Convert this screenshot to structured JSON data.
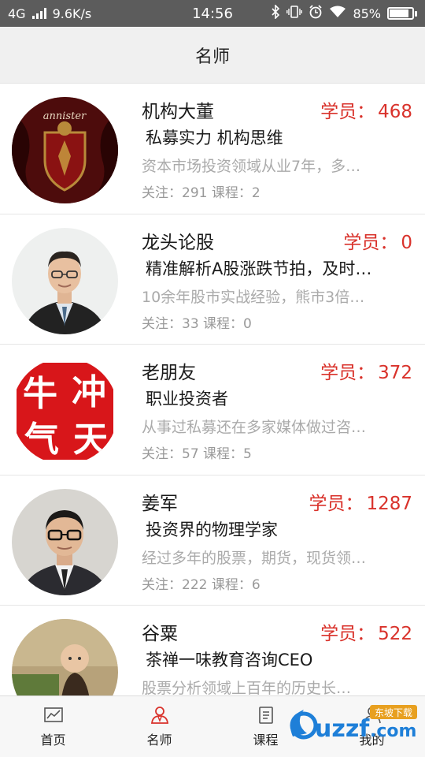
{
  "status_bar": {
    "network": "4G",
    "speed": "9.6K/s",
    "time": "14:56",
    "battery": "85%",
    "battery_level": 0.85
  },
  "header": {
    "title": "名师"
  },
  "colors": {
    "accent": "#d9322b",
    "header_bg": "#f0f0f0",
    "status_bg": "#5c5c5c"
  },
  "teachers": [
    {
      "name": "机构大董",
      "students_label": "学员：",
      "students": "468",
      "title": "私募实力 机构思维",
      "desc": "资本市场投资领域从业7年，多…",
      "stats": "关注：291 课程：2",
      "avatar_icon": "crest-avatar"
    },
    {
      "name": "龙头论股",
      "students_label": "学员：",
      "students": "0",
      "title": "精准解析A股涨跌节拍，及时…",
      "desc": "10余年股市实战经验，熊市3倍…",
      "stats": "关注：33 课程：0",
      "avatar_icon": "man-suit-avatar"
    },
    {
      "name": "老朋友",
      "students_label": "学员：",
      "students": "372",
      "title": "职业投资者",
      "desc": "从事过私募还在多家媒体做过咨…",
      "stats": "关注：57 课程：5",
      "avatar_icon": "seal-avatar"
    },
    {
      "name": "姜军",
      "students_label": "学员：",
      "students": "1287",
      "title": "投资界的物理学家",
      "desc": "经过多年的股票，期货，现货领…",
      "stats": "关注：222 课程：6",
      "avatar_icon": "man-glasses-avatar"
    },
    {
      "name": "谷粟",
      "students_label": "学员：",
      "students": "522",
      "title": "茶禅一味教育咨询CEO",
      "desc": "股票分析领域上百年的历史长…",
      "stats": "",
      "avatar_icon": "child-monk-avatar"
    }
  ],
  "seal_text": [
    "牛",
    "冲",
    "气",
    "天"
  ],
  "crest_text": "annister",
  "tabs": [
    {
      "label": "首页",
      "icon": "chart-icon"
    },
    {
      "label": "名师",
      "icon": "teacher-icon",
      "active": true
    },
    {
      "label": "课程",
      "icon": "course-icon"
    },
    {
      "label": "我的",
      "icon": "user-icon"
    }
  ],
  "watermark": {
    "text": "uzzf",
    "suffix": ".com",
    "tag": "东坡下载"
  }
}
